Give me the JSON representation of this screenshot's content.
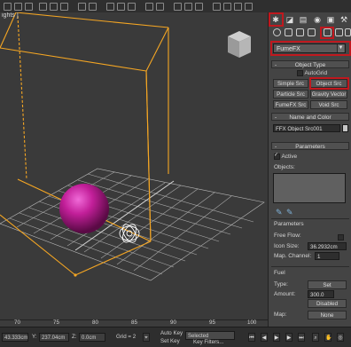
{
  "viewport": {
    "label": "ights ]"
  },
  "command_panel": {
    "tabs": [
      "create-icon",
      "modify-icon",
      "hierarchy-icon",
      "motion-icon",
      "display-icon",
      "utilities-icon"
    ],
    "subtabs": [
      "geometry-icon",
      "shapes-icon",
      "lights-icon",
      "cameras-icon",
      "helpers-icon",
      "spacewarps-icon",
      "systems-icon"
    ],
    "category_dropdown": "FumeFX",
    "object_type": {
      "title": "Object Type",
      "autogrid_label": "AutoGrid",
      "buttons": [
        "Simple Src",
        "Object Src",
        "Particle Src",
        "Gravity Vector",
        "FumeFX Src",
        "Void Src"
      ]
    },
    "name_and_color": {
      "title": "Name and Color",
      "name_value": "FFX Object Src001",
      "color": "#c7c7c7"
    },
    "parameters": {
      "title": "Parameters",
      "active_label": "Active",
      "objects_label": "Objects:",
      "sub_title": "Parameters",
      "free_flow_label": "Free Flow:",
      "icon_size_label": "Icon Size:",
      "icon_size_value": "36.2932cm",
      "map_channel_label": "Map. Channel:",
      "map_channel_value": "1"
    },
    "fuel": {
      "title": "Fuel",
      "type_label": "Type:",
      "type_value": "Set",
      "amount_label": "Amount:",
      "amount_value": "300.0",
      "disabled_label": "Disabled",
      "map_label": "Map:",
      "map_value": "None"
    }
  },
  "timeline": {
    "ticks": [
      "70",
      "75",
      "80",
      "85",
      "90",
      "95",
      "100"
    ]
  },
  "status_bar": {
    "x_value": "43.333cm",
    "y_label": "Y:",
    "y_value": "237.04cm",
    "z_label": "Z:",
    "z_value": "0.0cm",
    "grid_label": "Grid = 2",
    "autokey_label": "Auto Key",
    "selected_value": "Selected",
    "setkey_label": "Set Key",
    "keyfilters_label": "Key Filters..."
  },
  "colors": {
    "selection_box": "#f5a623",
    "sphere": "#c21f99",
    "highlight_border": "#c0181e"
  }
}
